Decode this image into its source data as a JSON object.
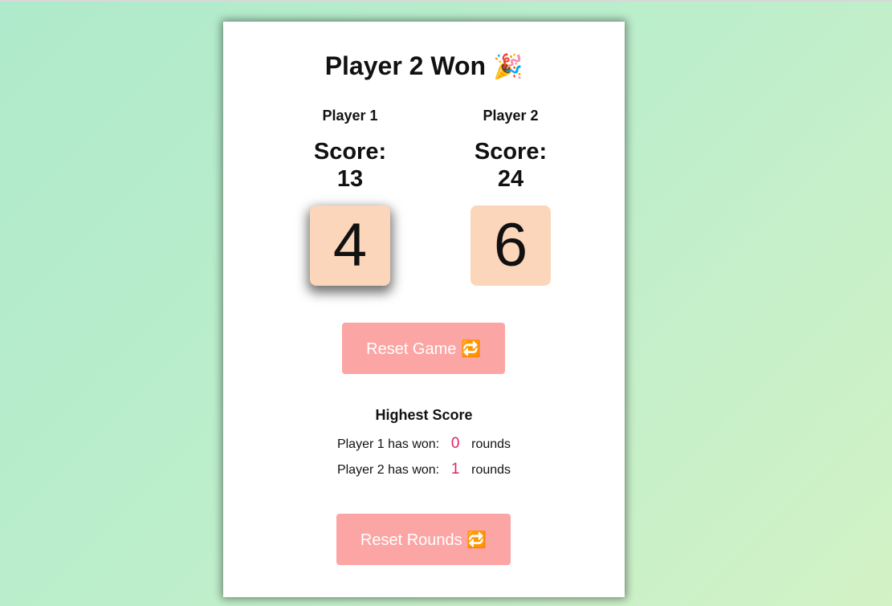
{
  "title": {
    "text": "Player 2 Won",
    "emoji": "🎉"
  },
  "players": [
    {
      "name": "Player 1",
      "score_label": "Score:",
      "score": "13",
      "die": "4"
    },
    {
      "name": "Player 2",
      "score_label": "Score:",
      "score": "24",
      "die": "6"
    }
  ],
  "buttons": {
    "reset_game": {
      "label": "Reset Game",
      "emoji": "🔁"
    },
    "reset_rounds": {
      "label": "Reset Rounds",
      "emoji": "🔁"
    }
  },
  "highest": {
    "title": "Highest Score",
    "rows": [
      {
        "prefix": "Player 1 has won:",
        "count": "0",
        "suffix": "rounds"
      },
      {
        "prefix": "Player 2 has won:",
        "count": "1",
        "suffix": "rounds"
      }
    ]
  },
  "colors": {
    "die_bg": "#fcd6bb",
    "button_bg": "#fba6a4",
    "count_color": "#e0245e"
  }
}
